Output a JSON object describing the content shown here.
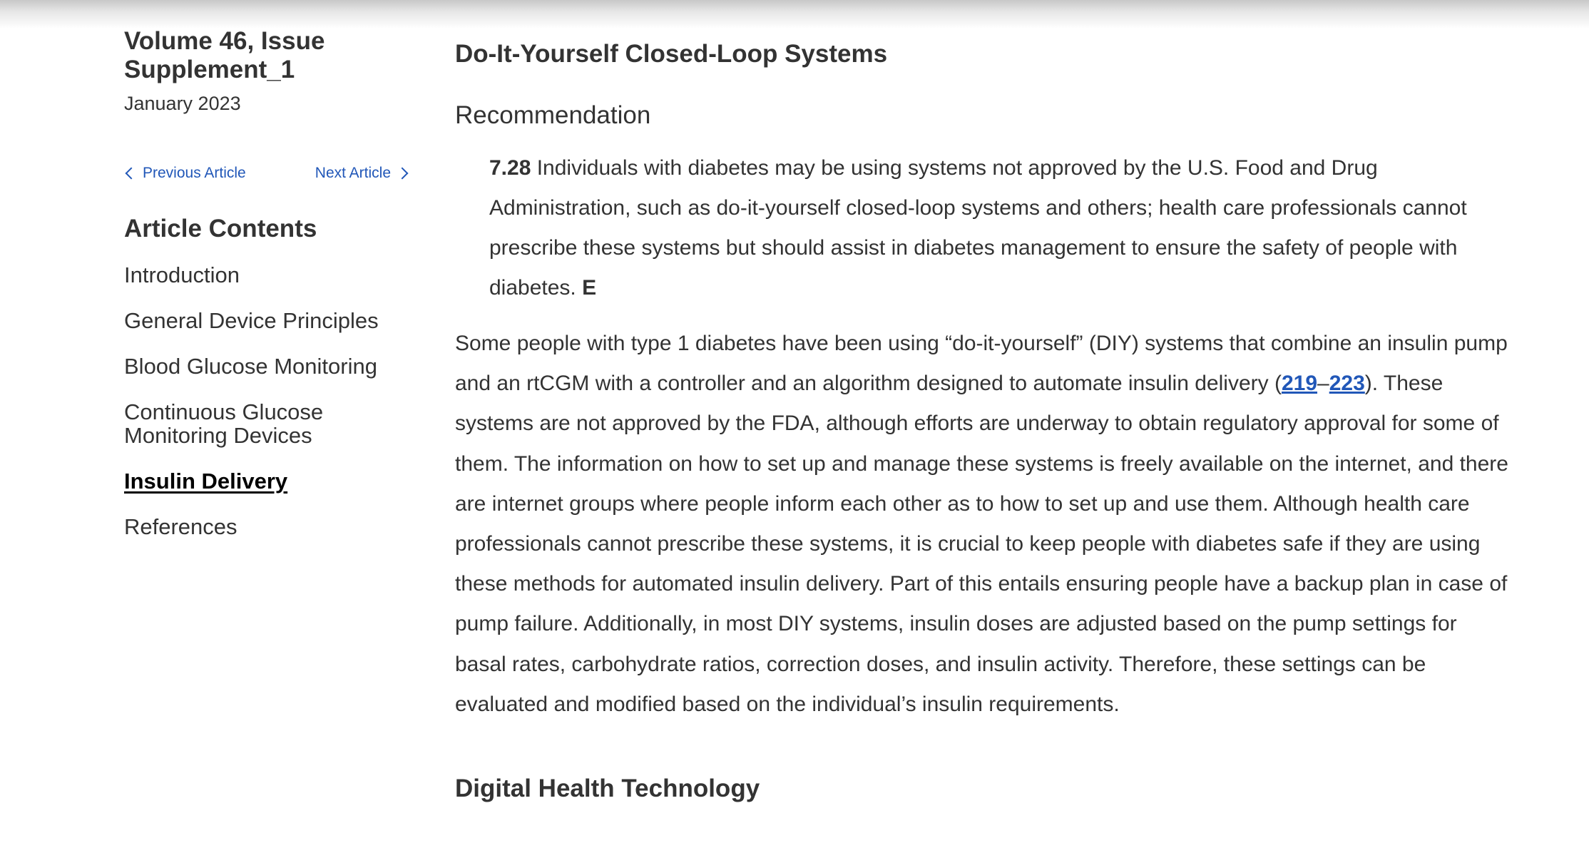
{
  "sidebar": {
    "issue_title_line1": "Volume 46, Issue",
    "issue_title_line2": "Supplement_1",
    "issue_date": "January 2023",
    "previous_article": "Previous Article",
    "next_article": "Next Article",
    "contents_title": "Article Contents",
    "contents": [
      {
        "label": "Introduction",
        "active": false
      },
      {
        "label": "General Device Principles",
        "active": false
      },
      {
        "label": "Blood Glucose Monitoring",
        "active": false
      },
      {
        "label": "Continuous Glucose Monitoring Devices",
        "active": false
      },
      {
        "label": "Insulin Delivery",
        "active": true
      },
      {
        "label": "References",
        "active": false
      }
    ]
  },
  "main": {
    "section_title": "Do-It-Yourself Closed-Loop Systems",
    "recommendation_label": "Recommendation",
    "recommendation": {
      "number": "7.28",
      "text": " Individuals with diabetes may be using systems not approved by the U.S. Food and Drug Administration, such as do-it-yourself closed-loop systems and others; health care professionals cannot prescribe these systems but should assist in diabetes management to ensure the safety of people with diabetes. ",
      "grade": "E"
    },
    "paragraph": {
      "part1": "Some people with type 1 diabetes have been using “do-it-yourself” (DIY) systems that combine an insulin pump and an rtCGM with a controller and an algorithm designed to automate insulin delivery (",
      "ref_start": "219",
      "ref_dash": "–",
      "ref_end": "223",
      "part2": "). These systems are not approved by the FDA, although efforts are underway to obtain regulatory approval for some of them. The information on how to set up and manage these systems is freely available on the internet, and there are internet groups where people inform each other as to how to set up and use them. Although health care professionals cannot prescribe these systems, it is crucial to keep people with diabetes safe if they are using these methods for automated insulin delivery. Part of this entails ensuring people have a backup plan in case of pump failure. Additionally, in most DIY systems, insulin doses are adjusted based on the pump settings for basal rates, carbohydrate ratios, correction doses, and insulin activity. Therefore, these settings can be evaluated and modified based on the individual’s insulin requirements."
    },
    "next_section_title": "Digital Health Technology"
  },
  "colors": {
    "link": "#2157b8",
    "text": "#333333"
  }
}
